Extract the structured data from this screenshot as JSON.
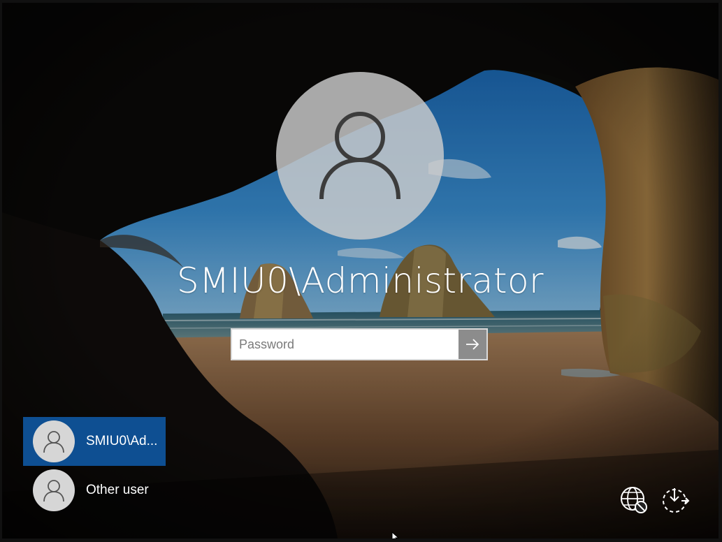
{
  "lockscreen": {
    "user_name": "SMIU0\\Administrator",
    "password_placeholder": "Password",
    "password_value": ""
  },
  "user_list": [
    {
      "label": "SMIU0\\Ad...",
      "selected": true
    },
    {
      "label": "Other user",
      "selected": false
    }
  ],
  "system_icons": [
    "network-icon",
    "ease-of-access-icon"
  ],
  "colors": {
    "selected_tile": "#0e4f92",
    "submit_button": "#8c8c8c",
    "avatar_circle": "#cdcdcd"
  }
}
